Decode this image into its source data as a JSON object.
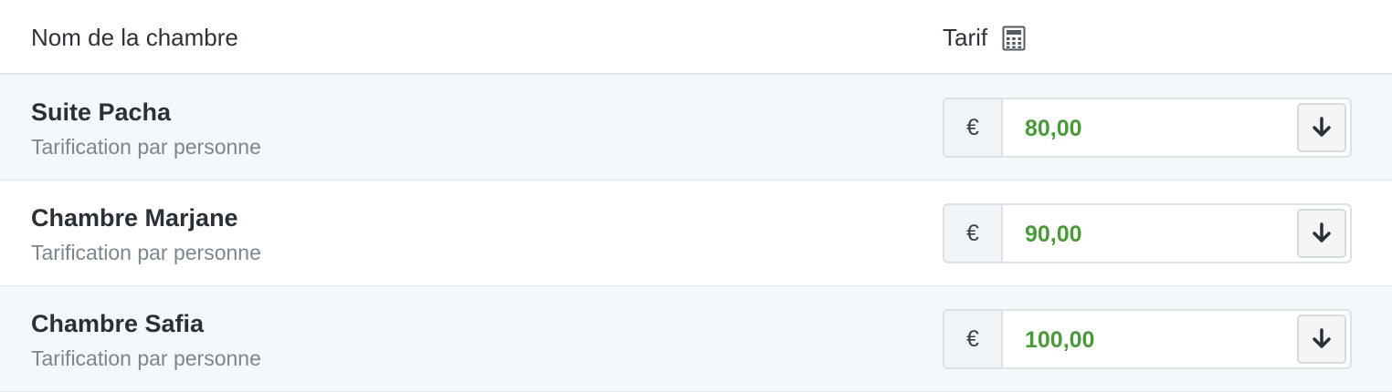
{
  "header": {
    "name_label": "Nom de la chambre",
    "tarif_label": "Tarif",
    "tarif_icon": "calculator-icon"
  },
  "rooms": [
    {
      "name": "Suite Pacha",
      "pricing": "Tarification par personne",
      "currency": "€",
      "price": "80,00"
    },
    {
      "name": "Chambre Marjane",
      "pricing": "Tarification par personne",
      "currency": "€",
      "price": "90,00"
    },
    {
      "name": "Chambre Safia",
      "pricing": "Tarification par personne",
      "currency": "€",
      "price": "100,00"
    }
  ],
  "colors": {
    "price_text": "#4a9a3a",
    "alt_row_bg": "#f5f8fa"
  },
  "icons": {
    "down": "arrow-down-icon"
  }
}
